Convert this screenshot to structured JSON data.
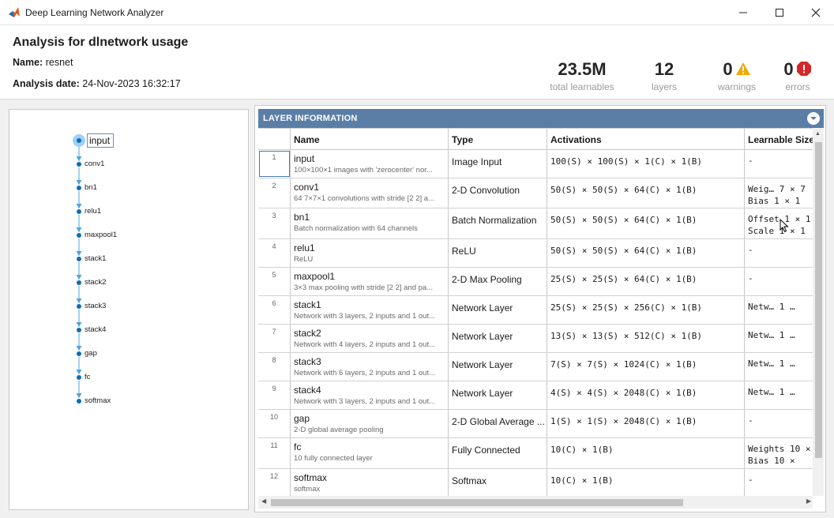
{
  "window": {
    "title": "Deep Learning Network Analyzer",
    "icon": "matlab-logo-icon",
    "controls": [
      "minimize-icon",
      "maximize-icon",
      "close-icon"
    ]
  },
  "header": {
    "title": "Analysis for dlnetwork usage",
    "name_label": "Name:",
    "name_value": "resnet",
    "date_label": "Analysis date:",
    "date_value": "24-Nov-2023 16:32:17",
    "stats": [
      {
        "value": "23.5M",
        "label": "total learnables"
      },
      {
        "value": "12",
        "label": "layers"
      },
      {
        "value": "0",
        "label": "warnings",
        "icon": "warning-icon",
        "color": "#f2a900"
      },
      {
        "value": "0",
        "label": "errors",
        "icon": "error-icon",
        "color": "#d62728"
      }
    ]
  },
  "graph": {
    "nodes": [
      "input",
      "conv1",
      "bn1",
      "relu1",
      "maxpool1",
      "stack1",
      "stack2",
      "stack3",
      "stack4",
      "gap",
      "fc",
      "softmax"
    ],
    "selected": "input",
    "node_color": "#0e6db5",
    "edge_color": "#4fa3de"
  },
  "layer_info": {
    "section_title": "LAYER INFORMATION",
    "columns": [
      "Name",
      "Type",
      "Activations",
      "Learnable Sizes"
    ],
    "rows": [
      {
        "idx": "1",
        "name": "input",
        "desc": "100×100×1 images with 'zerocenter' nor...",
        "type": "Image Input",
        "act": "100(S) × 100(S) × 1(C) × 1(B)",
        "learn": [
          "-"
        ]
      },
      {
        "idx": "2",
        "name": "conv1",
        "desc": "64 7×7×1 convolutions with stride [2 2] a...",
        "type": "2-D Convolution",
        "act": "50(S) × 50(S) × 64(C) × 1(B)",
        "learn": [
          "Weig…  7 × 7",
          "Bias   1 × 1"
        ]
      },
      {
        "idx": "3",
        "name": "bn1",
        "desc": "Batch normalization with 64 channels",
        "type": "Batch Normalization",
        "act": "50(S) × 50(S) × 64(C) × 1(B)",
        "learn": [
          "Offset  1 × 1",
          "Scale   1 × 1"
        ]
      },
      {
        "idx": "4",
        "name": "relu1",
        "desc": "ReLU",
        "type": "ReLU",
        "act": "50(S) × 50(S) × 64(C) × 1(B)",
        "learn": [
          "-"
        ]
      },
      {
        "idx": "5",
        "name": "maxpool1",
        "desc": "3×3 max pooling with stride [2 2] and pa...",
        "type": "2-D Max Pooling",
        "act": "25(S) × 25(S) × 64(C) × 1(B)",
        "learn": [
          "-"
        ]
      },
      {
        "idx": "6",
        "name": "stack1",
        "desc": "Network with 3 layers, 2 inputs and 1 out...",
        "type": "Network Layer",
        "act": "25(S) × 25(S) × 256(C) × 1(B)",
        "learn": [
          "Netw…   1 …"
        ]
      },
      {
        "idx": "7",
        "name": "stack2",
        "desc": "Network with 4 layers, 2 inputs and 1 out...",
        "type": "Network Layer",
        "act": "13(S) × 13(S) × 512(C) × 1(B)",
        "learn": [
          "Netw…   1 …"
        ]
      },
      {
        "idx": "8",
        "name": "stack3",
        "desc": "Network with 6 layers, 2 inputs and 1 out...",
        "type": "Network Layer",
        "act": "7(S) × 7(S) × 1024(C) × 1(B)",
        "learn": [
          "Netw…   1 …"
        ]
      },
      {
        "idx": "9",
        "name": "stack4",
        "desc": "Network with 3 layers, 2 inputs and 1 out...",
        "type": "Network Layer",
        "act": "4(S) × 4(S) × 2048(C) × 1(B)",
        "learn": [
          "Netw…   1 …"
        ]
      },
      {
        "idx": "10",
        "name": "gap",
        "desc": "2-D global average pooling",
        "type": "2-D Global Average ...",
        "act": "1(S) × 1(S) × 2048(C) × 1(B)",
        "learn": [
          "-"
        ]
      },
      {
        "idx": "11",
        "name": "fc",
        "desc": "10 fully connected layer",
        "type": "Fully Connected",
        "act": "10(C) × 1(B)",
        "learn": [
          "Weights  10 ×",
          "Bias     10 ×"
        ]
      },
      {
        "idx": "12",
        "name": "softmax",
        "desc": "softmax",
        "type": "Softmax",
        "act": "10(C) × 1(B)",
        "learn": [
          "-"
        ]
      }
    ]
  }
}
